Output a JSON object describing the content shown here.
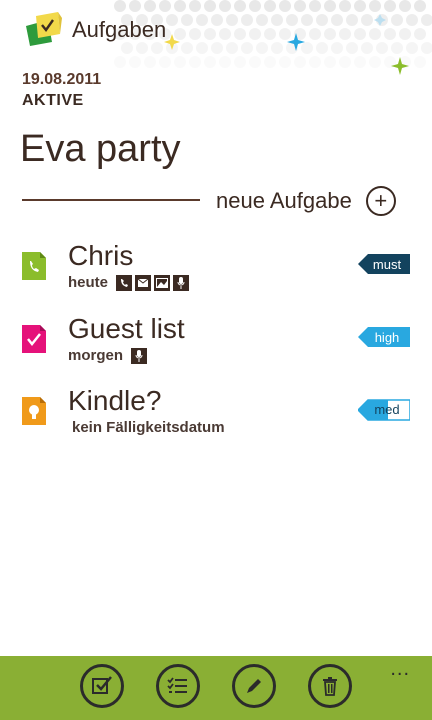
{
  "app": {
    "title": "Aufgaben"
  },
  "header": {
    "date": "19.08.2011",
    "filter": "AKTIVE"
  },
  "list": {
    "title": "Eva party",
    "new_task_label": "neue Aufgabe"
  },
  "tasks": [
    {
      "title": "Chris",
      "due": "heute",
      "icon": "phone-icon",
      "icon_color": "#8bbd2b",
      "meta_icons": [
        "phone-icon",
        "mail-icon",
        "image-icon",
        "microphone-icon"
      ],
      "priority": "must",
      "priority_color": "#13435e"
    },
    {
      "title": "Guest list",
      "due": "morgen",
      "icon": "checkmark-icon",
      "icon_color": "#e5127a",
      "meta_icons": [
        "microphone-icon"
      ],
      "priority": "high",
      "priority_color": "#29a8e0"
    },
    {
      "title": "Kindle?",
      "due": "kein Fälligkeitsdatum",
      "icon": "lightbulb-icon",
      "icon_color": "#f09a1a",
      "meta_icons": [],
      "priority": "med",
      "priority_color": "#29a8e0"
    }
  ],
  "appbar": {
    "buttons": [
      "check-icon",
      "list-icon",
      "edit-icon",
      "delete-icon"
    ],
    "more": "..."
  }
}
